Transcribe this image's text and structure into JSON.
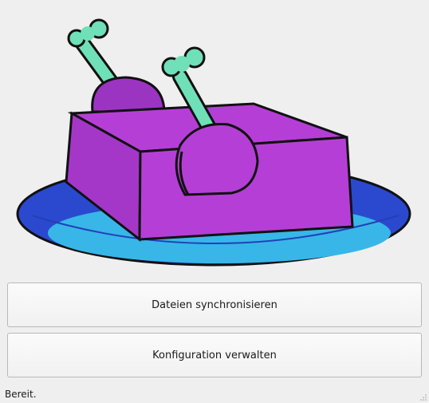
{
  "illustration": {
    "subject": "purple box with drumsticks on blue plate",
    "colors": {
      "plate_outer": "#2b49cf",
      "plate_inner": "#38b6e8",
      "box": "#b53fd6",
      "box_dark": "#8c2fae",
      "bone": "#6fe0b8",
      "outline": "#111111"
    }
  },
  "buttons": {
    "sync_label": "Dateien synchronisieren",
    "config_label": "Konfiguration verwalten"
  },
  "status": {
    "text": "Bereit."
  }
}
